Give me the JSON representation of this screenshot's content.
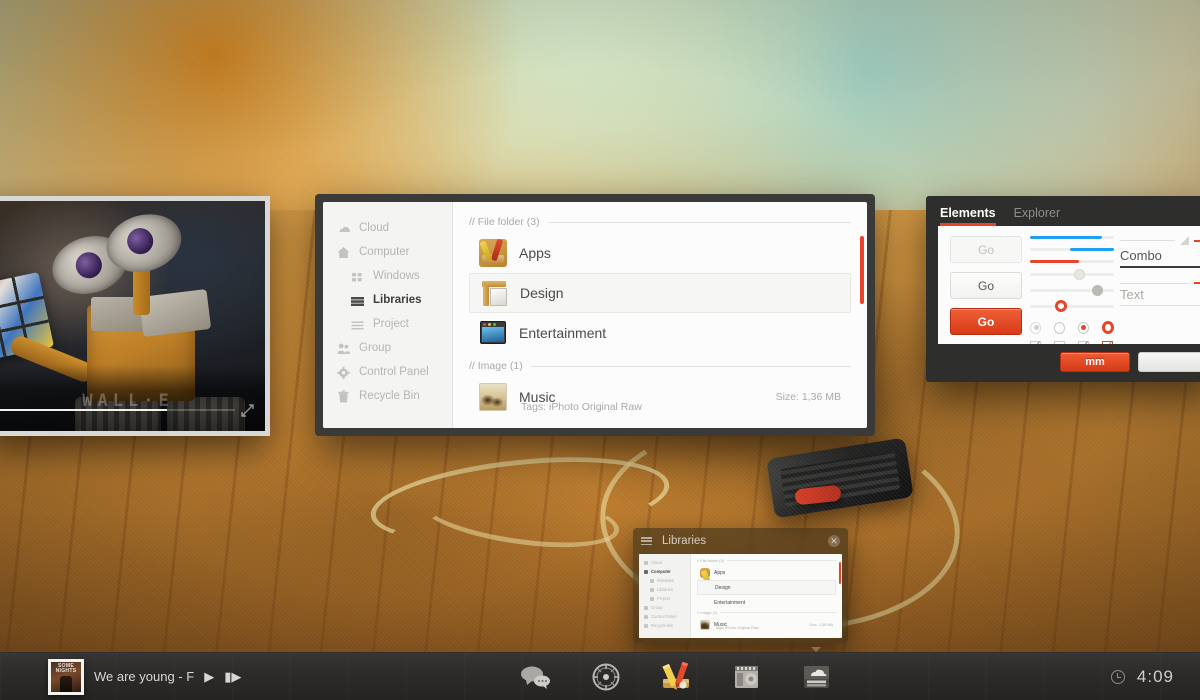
{
  "desktop": {
    "name": "desktop-wallpaper"
  },
  "video_player": {
    "title": "WALL·E",
    "progress_percent": 72,
    "expand_icon": "expand-icon"
  },
  "file_manager": {
    "sidebar": [
      {
        "label": "Cloud",
        "icon": "cloud-icon",
        "indent": false,
        "active": false
      },
      {
        "label": "Computer",
        "icon": "home-icon",
        "indent": false,
        "active": false
      },
      {
        "label": "Windows",
        "icon": "grid-icon",
        "indent": true,
        "active": false
      },
      {
        "label": "Libraries",
        "icon": "list-icon",
        "indent": true,
        "active": true
      },
      {
        "label": "Project",
        "icon": "list-icon",
        "indent": true,
        "active": false
      },
      {
        "label": "Group",
        "icon": "people-icon",
        "indent": false,
        "active": false
      },
      {
        "label": "Control Panel",
        "icon": "gear-icon",
        "indent": false,
        "active": false
      },
      {
        "label": "Recycle Bin",
        "icon": "trash-icon",
        "indent": false,
        "active": false
      }
    ],
    "groups": [
      {
        "header": "// File folder (3)",
        "rows": [
          {
            "name": "Apps",
            "icon": "apps-folder-icon",
            "selected": false,
            "sub": "",
            "size": ""
          },
          {
            "name": "Design",
            "icon": "design-folder-icon",
            "selected": true,
            "sub": "",
            "size": ""
          },
          {
            "name": "Entertainment",
            "icon": "entertainment-folder-icon",
            "selected": false,
            "sub": "",
            "size": ""
          }
        ]
      },
      {
        "header": "// Image (1)",
        "rows": [
          {
            "name": "Music",
            "icon": "image-thumb-icon",
            "selected": false,
            "sub": "Tags: iPhoto Original Raw",
            "size": "Size: 1,36 MB"
          }
        ]
      }
    ],
    "scrollbar_color": "#e8442a"
  },
  "elements_panel": {
    "tabs": [
      {
        "label": "Elements",
        "active": true
      },
      {
        "label": "Explorer",
        "active": false
      }
    ],
    "buttons": [
      {
        "label": "Go",
        "state": "disabled"
      },
      {
        "label": "Go",
        "state": "normal"
      },
      {
        "label": "Go",
        "state": "primary"
      }
    ],
    "bars": [
      {
        "color": "#1e9ff2",
        "fill_percent": 86,
        "offset_percent": 0
      },
      {
        "color": "#1e9ff2",
        "fill_percent": 52,
        "offset_percent": 48
      },
      {
        "color": "#e8442a",
        "fill_percent": 58,
        "offset_percent": 0
      }
    ],
    "sliders": [
      {
        "knob": "grey",
        "position_percent": 52
      },
      {
        "knob": "grey2",
        "position_percent": 74
      },
      {
        "knob": "red",
        "position_percent": 30
      }
    ],
    "radios": [
      "disabled",
      "empty",
      "selected",
      "selected-red"
    ],
    "checkboxes": [
      "checked-grey",
      "empty",
      "checked-grey",
      "checked-red"
    ],
    "combo": {
      "label": "Combo",
      "accent": "#e8442a"
    },
    "text": {
      "label": "Text",
      "accent": "#e8442a"
    },
    "footer_buttons": [
      {
        "label": "mm",
        "style": "red"
      },
      {
        "label": "",
        "style": "light"
      }
    ]
  },
  "mini_window": {
    "title": "Libraries",
    "menu_icon": "hamburger-icon",
    "close_icon": "close-icon",
    "sidebar": [
      {
        "label": "Cloud",
        "indent": false,
        "active": false
      },
      {
        "label": "Computer",
        "indent": false,
        "active": true
      },
      {
        "label": "Windows",
        "indent": true,
        "active": false
      },
      {
        "label": "Libraries",
        "indent": true,
        "active": false
      },
      {
        "label": "Project",
        "indent": true,
        "active": false
      },
      {
        "label": "Group",
        "indent": false,
        "active": false
      },
      {
        "label": "Control Panel",
        "indent": false,
        "active": false
      },
      {
        "label": "Recycle Bin",
        "indent": false,
        "active": false
      }
    ],
    "group1_header": "// File folder (3)",
    "group2_header": "// Image (1)",
    "rows": [
      {
        "name": "Apps",
        "selected": false
      },
      {
        "name": "Design",
        "selected": true
      },
      {
        "name": "Entertainment",
        "selected": false
      }
    ],
    "image_row": {
      "name": "Music",
      "sub": "Tags: iPhoto Original Raw",
      "size": "Size: 1,36 MB"
    }
  },
  "taskbar": {
    "player": {
      "album_text": "SOME\\nNIGHTS",
      "track": "We are young - F",
      "play_icon": "play-icon",
      "next_icon": "next-track-icon"
    },
    "icons": [
      {
        "name": "chat-icon",
        "indicator": false
      },
      {
        "name": "compass-icon",
        "indicator": false
      },
      {
        "name": "apps-pencil-icon",
        "indicator": false
      },
      {
        "name": "notes-icon",
        "indicator": false
      },
      {
        "name": "cloud-app-icon",
        "indicator": true
      }
    ],
    "clock": {
      "icon": "clock-icon",
      "time": "4:09"
    }
  }
}
